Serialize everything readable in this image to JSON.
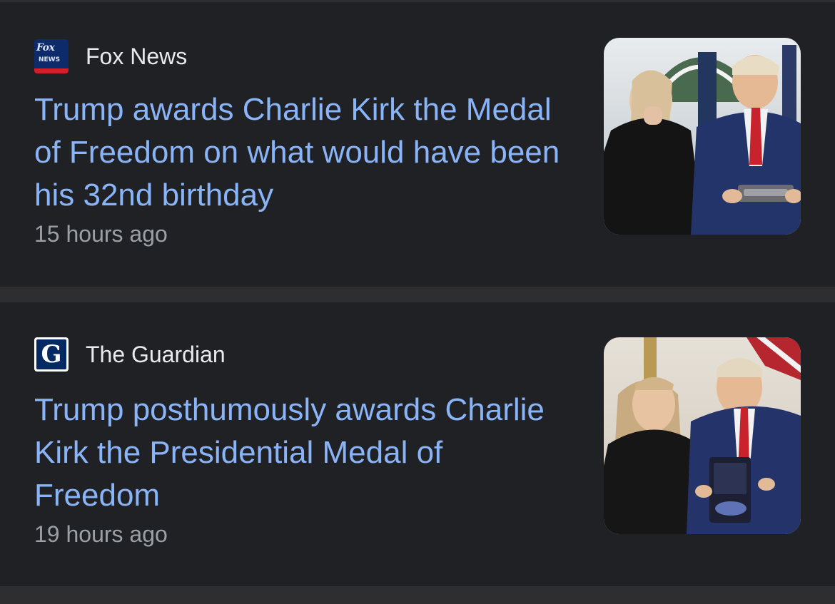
{
  "articles": [
    {
      "source": {
        "name": "Fox News",
        "logo_icon": "fox-news-logo-icon",
        "logo_text_top": "Fox",
        "logo_text_bottom": "NEWS"
      },
      "headline": "Trump awards Charlie Kirk the Medal of Freedom on what would have been his 32nd birthday",
      "timestamp": "15 hours ago",
      "thumbnail_icon": "news-photo-thumbnail"
    },
    {
      "source": {
        "name": "The Guardian",
        "logo_icon": "guardian-logo-icon",
        "logo_text": "G"
      },
      "headline": "Trump posthumously awards Charlie Kirk the Presidential Medal of Freedom",
      "timestamp": "19 hours ago",
      "thumbnail_icon": "news-photo-thumbnail"
    }
  ],
  "colors": {
    "background": "#2e2e30",
    "card": "#202124",
    "headline": "#8ab4f8",
    "source_text": "#e8eaed",
    "timestamp": "#9aa0a6"
  }
}
